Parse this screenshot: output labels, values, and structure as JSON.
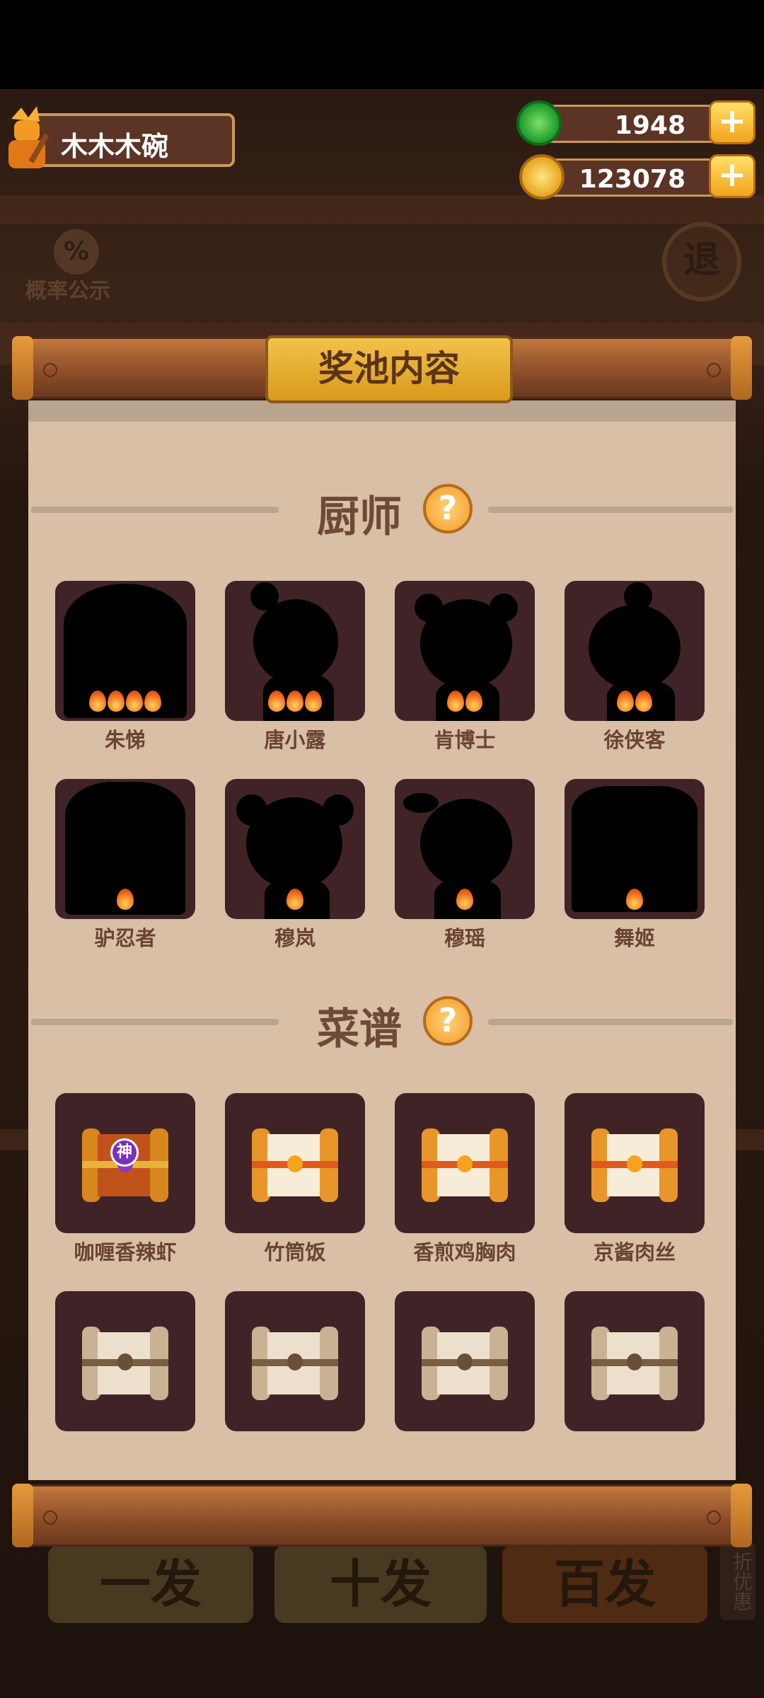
{
  "player": {
    "name": "木木木碗"
  },
  "currency": {
    "jade": {
      "value": "1948",
      "icon": "jade-coin-icon"
    },
    "gold": {
      "value": "123078",
      "icon": "gold-coin-icon"
    },
    "plus_label": "+"
  },
  "background": {
    "probability_label": "概率公示",
    "probability_symbol": "%",
    "quit_label": "退",
    "buttons": [
      "一发",
      "十发",
      "百发"
    ],
    "side_tab": "折优惠"
  },
  "panel": {
    "title": "奖池内容",
    "chef_section": "厨师",
    "recipe_section": "菜谱",
    "help_symbol": "?"
  },
  "chefs": [
    {
      "name": "朱悌",
      "stars": 4
    },
    {
      "name": "唐小露",
      "stars": 3
    },
    {
      "name": "肯博士",
      "stars": 2
    },
    {
      "name": "徐侠客",
      "stars": 2
    },
    {
      "name": "驴忍者",
      "stars": 1
    },
    {
      "name": "穆岚",
      "stars": 1
    },
    {
      "name": "穆瑶",
      "stars": 1
    },
    {
      "name": "舞姬",
      "stars": 1
    }
  ],
  "recipes": [
    {
      "name": "咖喱香辣虾",
      "icon": "divine-recipe-chest-icon",
      "badge": "神"
    },
    {
      "name": "竹筒饭",
      "icon": "gold-recipe-scroll-icon"
    },
    {
      "name": "香煎鸡胸肉",
      "icon": "gold-recipe-scroll-icon"
    },
    {
      "name": "京酱肉丝",
      "icon": "gold-recipe-scroll-icon"
    },
    {
      "name": "",
      "icon": "plain-recipe-scroll-icon"
    },
    {
      "name": "",
      "icon": "plain-recipe-scroll-icon"
    },
    {
      "name": "",
      "icon": "plain-recipe-scroll-icon"
    },
    {
      "name": "",
      "icon": "plain-recipe-scroll-icon"
    }
  ]
}
